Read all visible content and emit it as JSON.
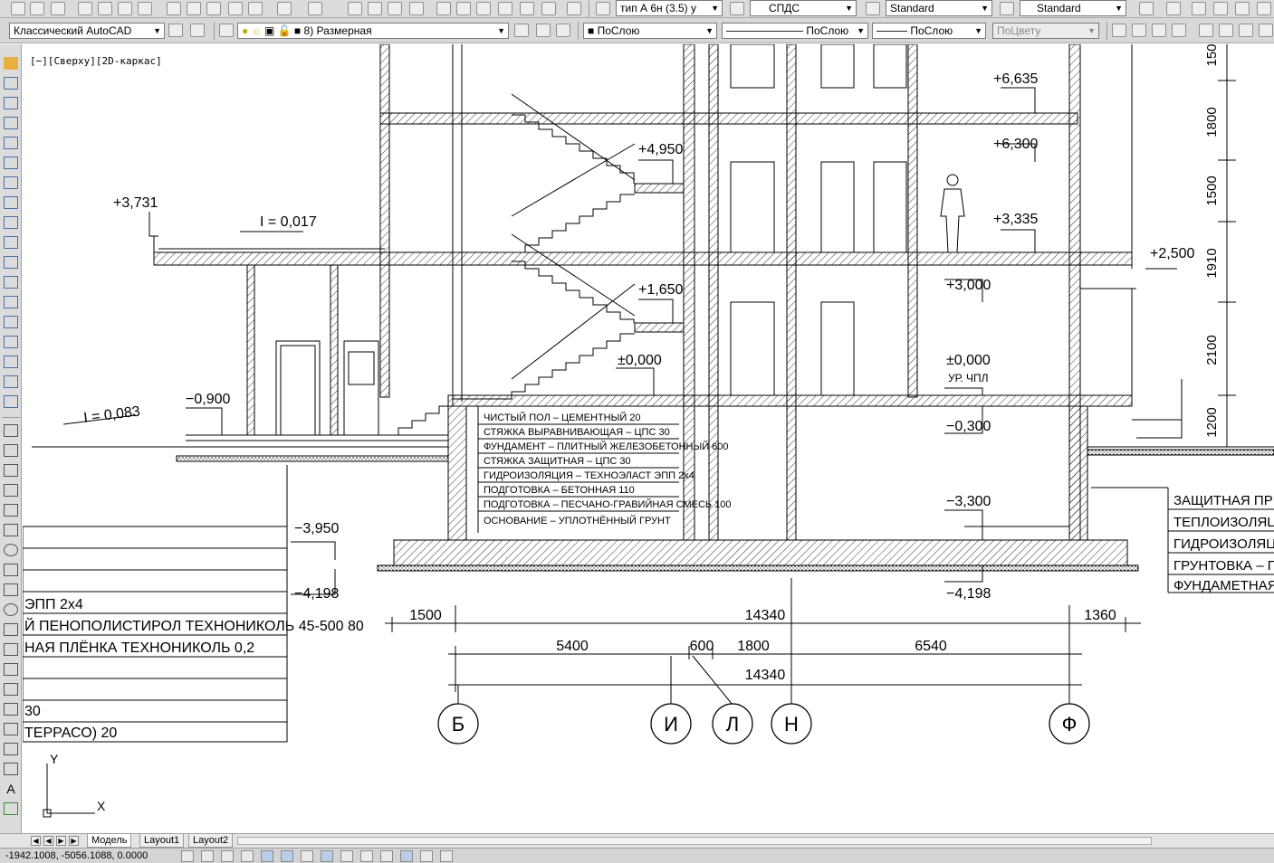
{
  "toolbar_top": {
    "text_style": "тип А 6н (3.5) у",
    "dim_style": "СПДС",
    "table_style": "Standard",
    "multileader_style": "Standard"
  },
  "toolbar_second": {
    "workspace": "Классический AutoCAD",
    "layer": "8) Размерная",
    "color": "ПоСлою",
    "linetype": "ПоСлою",
    "lineweight": "ПоСлою",
    "plotstyle": "ПоЦвету"
  },
  "viewport_label": "[−][Сверху][2D-каркас]",
  "drawing": {
    "level_marks": [
      "+6,635",
      "+6,300",
      "+4,950",
      "+3,731",
      "+3,335",
      "+3,000",
      "+2,500",
      "+1,650",
      "±0,000",
      "±0,000",
      "УР. ЧПЛ",
      "−0,300",
      "−0,900",
      "−3,300",
      "−3,950",
      "−4,198",
      "−4,198"
    ],
    "slopes": [
      "I = 0,017",
      "I = 0,083"
    ],
    "floor_layers": [
      "ЧИСТЫЙ ПОЛ – ЦЕМЕНТНЫЙ   20",
      "СТЯЖКА ВЫРАВНИВАЮЩАЯ – ЦПС   30",
      "ФУНДАМЕНТ – ПЛИТНЫЙ ЖЕЛЕЗОБЕТОННЫЙ   600",
      "СТЯЖКА ЗАЩИТНАЯ – ЦПС   30",
      "ГИДРОИЗОЛЯЦИЯ – ТЕХНОЭЛАСТ ЭПП   2х4",
      "ПОДГОТОВКА – БЕТОННАЯ   110",
      "ПОДГОТОВКА – ПЕСЧАНО-ГРАВИЙНАЯ СМЕСЬ   100",
      "ОСНОВАНИЕ – УПЛОТНЁННЫЙ ГРУНТ"
    ],
    "left_layers": [
      "ЭПП   2х4",
      "Й ПЕНОПОЛИСТИРОЛ ТЕХНОНИКОЛЬ 45-500   80",
      "НАЯ ПЛЁНКА ТЕХНОНИКОЛЬ   0,2",
      "30",
      "ТЕРРАСО)   20"
    ],
    "right_layers": [
      "ЗАЩИТНАЯ ПРИЖИМ",
      "ТЕПЛОИЗОЛЯЦИЯ –",
      "ГИДРОИЗОЛЯЦИЯ –",
      "ГРУНТОВКА – ПРАЙ",
      "ФУНДАМЕТНАЯ СТЕ"
    ],
    "dims_row1": [
      "1500",
      "14340",
      "1360"
    ],
    "dims_row2": [
      "5400",
      "600",
      "1800",
      "6540"
    ],
    "dims_row3": [
      "14340"
    ],
    "vertical_dims": [
      "150",
      "1800",
      "1500",
      "1910",
      "2100",
      "1200"
    ],
    "axes": [
      "Б",
      "И",
      "Л",
      "Н",
      "Ф"
    ],
    "ucs_x": "X",
    "ucs_y": "Y"
  },
  "tabs": [
    "Модель",
    "Layout1",
    "Layout2"
  ],
  "status": {
    "coordinates": "-1942.1008, -5056.1088, 0.0000"
  }
}
